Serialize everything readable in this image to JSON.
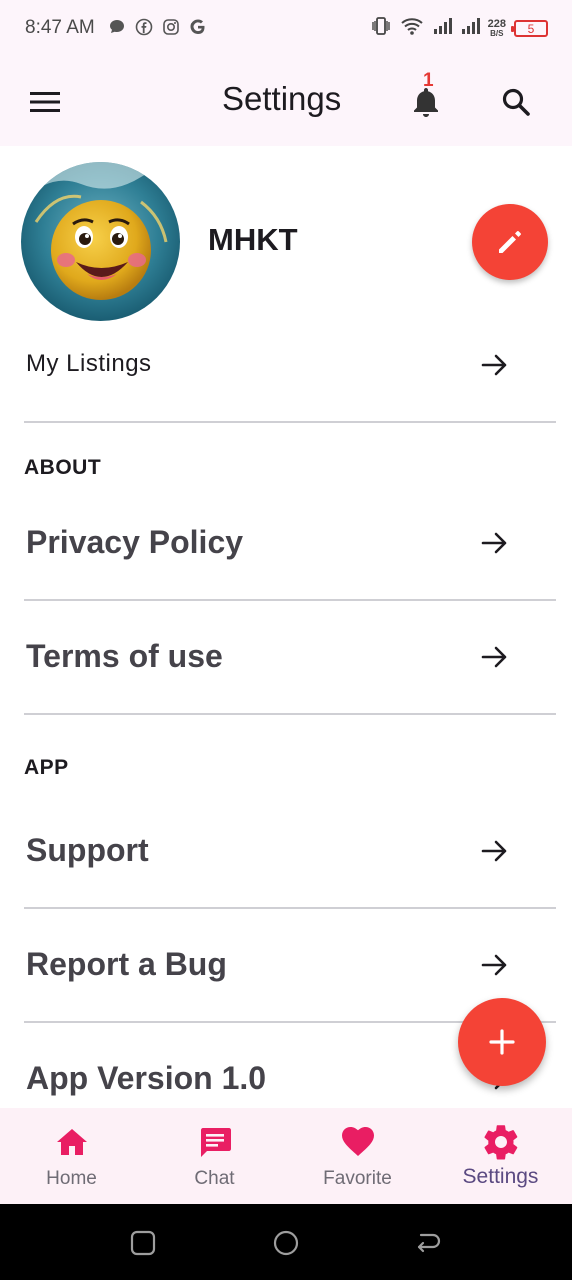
{
  "status_bar": {
    "time": "8:47 AM",
    "left_icons": [
      "chat-bubble-icon",
      "facebook-icon",
      "instagram-icon",
      "google-icon"
    ],
    "net_speed_value": "228",
    "net_speed_unit": "B/S",
    "battery_level": "5",
    "battery_color": "#dd3333"
  },
  "app_bar": {
    "title": "Settings",
    "notification_count": "1",
    "background": "#fdf5fb"
  },
  "profile": {
    "name": "MHKT",
    "avatar": "emoji-splash-avatar"
  },
  "rows": {
    "my_listings": "My Listings",
    "privacy_policy": "Privacy Policy",
    "terms_of_use": "Terms of use",
    "support": "Support",
    "report_bug": "Report a Bug",
    "app_version": "App Version 1.0"
  },
  "sections": {
    "about": "ABOUT",
    "app": "APP"
  },
  "bottom_nav": {
    "items": [
      {
        "label": "Home",
        "icon": "home-icon"
      },
      {
        "label": "Chat",
        "icon": "chat-icon"
      },
      {
        "label": "Favorite",
        "icon": "heart-icon"
      },
      {
        "label": "Settings",
        "icon": "gear-icon"
      }
    ],
    "active": "Settings",
    "accent": "#e91e63"
  },
  "colors": {
    "fab": "#f44336",
    "divider": "#cfcfd4"
  }
}
